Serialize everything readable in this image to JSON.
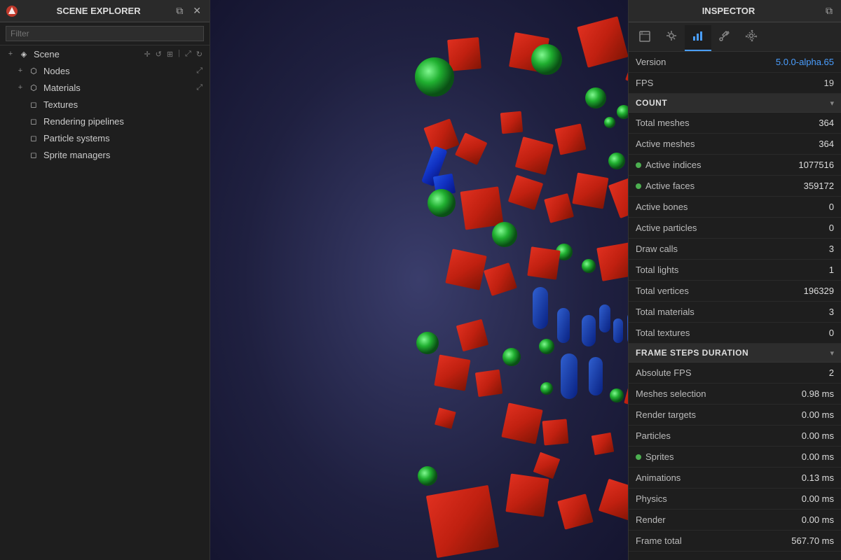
{
  "sceneExplorer": {
    "title": "SCENE EXPLORER",
    "filter": {
      "placeholder": "Filter",
      "value": ""
    },
    "items": [
      {
        "id": "scene",
        "label": "Scene",
        "expanded": true,
        "indent": 0,
        "actions": [
          "move",
          "refresh",
          "grid",
          "expand",
          "refresh2"
        ]
      },
      {
        "id": "nodes",
        "label": "Nodes",
        "expanded": false,
        "indent": 1,
        "actions": [
          "expand"
        ]
      },
      {
        "id": "materials",
        "label": "Materials",
        "expanded": false,
        "indent": 1,
        "actions": [
          "expand"
        ]
      },
      {
        "id": "textures",
        "label": "Textures",
        "expanded": false,
        "indent": 1,
        "actions": []
      },
      {
        "id": "rendering-pipelines",
        "label": "Rendering pipelines",
        "expanded": false,
        "indent": 1,
        "actions": []
      },
      {
        "id": "particle-systems",
        "label": "Particle systems",
        "expanded": false,
        "indent": 1,
        "actions": []
      },
      {
        "id": "sprite-managers",
        "label": "Sprite managers",
        "expanded": false,
        "indent": 1,
        "actions": []
      }
    ]
  },
  "inspector": {
    "title": "INSPECTOR",
    "tabs": [
      {
        "id": "scene",
        "icon": "📄",
        "label": "scene-tab"
      },
      {
        "id": "debug",
        "icon": "🐛",
        "label": "debug-tab"
      },
      {
        "id": "stats",
        "icon": "📊",
        "label": "stats-tab",
        "active": true
      },
      {
        "id": "tools",
        "icon": "🔧",
        "label": "tools-tab"
      },
      {
        "id": "settings",
        "icon": "⚙",
        "label": "settings-tab"
      }
    ],
    "version": {
      "label": "Version",
      "value": "5.0.0-alpha.65"
    },
    "fps": {
      "label": "FPS",
      "value": "19"
    },
    "sections": [
      {
        "id": "count",
        "title": "COUNT",
        "expanded": true,
        "rows": [
          {
            "id": "total-meshes",
            "label": "Total meshes",
            "value": "364",
            "dot": false
          },
          {
            "id": "active-meshes",
            "label": "Active meshes",
            "value": "364",
            "dot": false
          },
          {
            "id": "active-indices",
            "label": "Active indices",
            "value": "1077516",
            "dot": true
          },
          {
            "id": "active-faces",
            "label": "Active faces",
            "value": "359172",
            "dot": true
          },
          {
            "id": "active-bones",
            "label": "Active bones",
            "value": "0",
            "dot": false
          },
          {
            "id": "active-particles",
            "label": "Active particles",
            "value": "0",
            "dot": false
          },
          {
            "id": "draw-calls",
            "label": "Draw calls",
            "value": "3",
            "dot": false
          },
          {
            "id": "total-lights",
            "label": "Total lights",
            "value": "1",
            "dot": false
          },
          {
            "id": "total-vertices",
            "label": "Total vertices",
            "value": "196329",
            "dot": false
          },
          {
            "id": "total-materials",
            "label": "Total materials",
            "value": "3",
            "dot": false
          },
          {
            "id": "total-textures",
            "label": "Total textures",
            "value": "0",
            "dot": false
          }
        ]
      },
      {
        "id": "frame-steps",
        "title": "FRAME STEPS DURATION",
        "expanded": true,
        "rows": [
          {
            "id": "absolute-fps",
            "label": "Absolute FPS",
            "value": "2",
            "dot": false
          },
          {
            "id": "meshes-selection",
            "label": "Meshes selection",
            "value": "0.98 ms",
            "dot": false
          },
          {
            "id": "render-targets",
            "label": "Render targets",
            "value": "0.00 ms",
            "dot": false
          },
          {
            "id": "particles",
            "label": "Particles",
            "value": "0.00 ms",
            "dot": false
          },
          {
            "id": "sprites",
            "label": "Sprites",
            "value": "0.00 ms",
            "dot": true
          },
          {
            "id": "animations",
            "label": "Animations",
            "value": "0.13 ms",
            "dot": false
          },
          {
            "id": "physics",
            "label": "Physics",
            "value": "0.00 ms",
            "dot": false
          },
          {
            "id": "render",
            "label": "Render",
            "value": "0.00 ms",
            "dot": false
          },
          {
            "id": "frame-total",
            "label": "Frame total",
            "value": "567.70 ms",
            "dot": false
          }
        ]
      }
    ]
  },
  "colors": {
    "accent": "#4a9eff",
    "green": "#4caf50",
    "panelBg": "#1e1e1e",
    "sectionBg": "#2d2d2d"
  }
}
